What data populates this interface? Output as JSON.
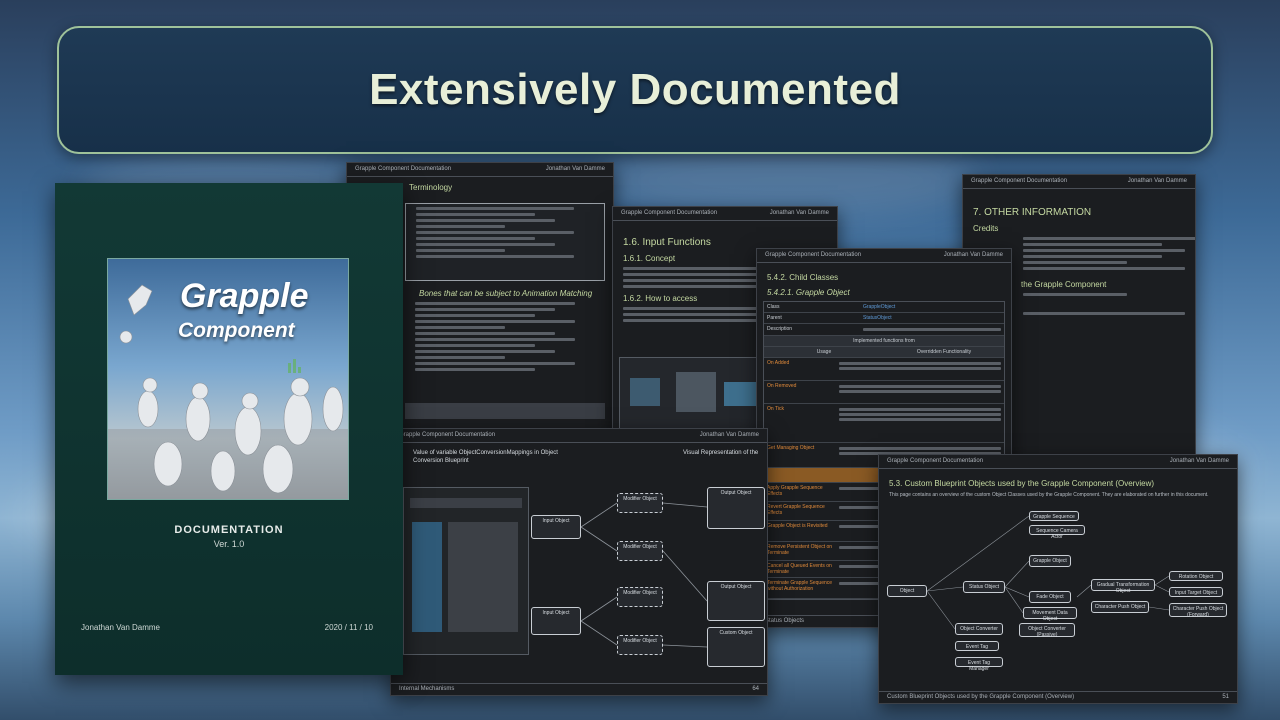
{
  "title": "Extensively Documented",
  "cover": {
    "logo_line1": "Grapple",
    "logo_line2": "Component",
    "doc_label": "DOCUMENTATION",
    "version": "Ver. 1.0",
    "author": "Jonathan Van Damme",
    "date": "2020 / 11 / 10"
  },
  "pages": {
    "terminology": {
      "header_left": "Grapple Component Documentation",
      "header_right": "Jonathan Van Damme",
      "section": "Terminology",
      "section2": "Bones that can be subject to Animation Matching"
    },
    "input_functions": {
      "header_left": "Grapple Component Documentation",
      "header_right": "Jonathan Van Damme",
      "section": "1.6.    Input Functions",
      "sub1": "1.6.1. Concept",
      "sub2": "1.6.2. How to access"
    },
    "other_info": {
      "header_left": "Grapple Component Documentation",
      "header_right": "Jonathan Van Damme",
      "section": "7.   OTHER INFORMATION",
      "sub1": "Credits",
      "sub2": "the Grapple Component"
    },
    "child_classes": {
      "header_left": "Grapple Component Documentation",
      "header_right": "Jonathan Van Damme",
      "section": "5.4.2. Child Classes",
      "sub1": "5.4.2.1.      Grapple Object",
      "table_head_left": "Usage",
      "table_head_right": "Overridden Functionality",
      "table_title": "Implemented functions from",
      "rows": [
        "Class",
        "Parent",
        "Description",
        "On Added",
        "On Removed",
        "On Tick",
        "Get Managing Object",
        "Apply Grapple Sequence Effects",
        "Revert Grapple Sequence Effects",
        "Grapple Object is Revisited",
        "Remove Persistent Object on Terminate",
        "Cancel all Queued Events on Terminate",
        "Terminate Grapple Sequence without Authorization"
      ],
      "footer_left": "Status Objects"
    },
    "variable": {
      "header_left": "Grapple Component Documentation",
      "header_right": "Jonathan Van Damme",
      "title_left": "Value of variable ObjectConversionMappings in Object Conversion Blueprint",
      "title_right": "Visual Representation of the",
      "node_input1": "Input Object",
      "node_input2": "Input Object",
      "node_mod1": "Modifier Object",
      "node_mod2": "Modifier Object",
      "node_mod3": "Modifier Object",
      "node_mod4": "Modifier Object",
      "node_out1": "Output Object",
      "node_out2": "Output Object",
      "node_out3": "Custom Object",
      "footer_left": "Internal Mechanisms",
      "footer_right": "64"
    },
    "custom_objects": {
      "header_left": "Grapple Component Documentation",
      "header_right": "Jonathan Van Damme",
      "section": "5.3.  Custom Blueprint Objects used by the Grapple Component (Overview)",
      "intro": "This page contains an overview of the custom Object Classes used by the Grapple Component. They are elaborated on further in this document.",
      "nodes": [
        "Object",
        "Status Object",
        "Grapple Object",
        "Fade Object",
        "Movement Data Object",
        "Object Converter",
        "Event Tag",
        "Event Tag Manager",
        "Grapple Sequence",
        "Sequence Camera Actor",
        "Gradual Transformation Object",
        "Character Push Object",
        "Object Converter (Passive)"
      ],
      "nodes_right": [
        "Rotation Object",
        "Input Target Object",
        "Character Push Object (Forward)"
      ],
      "footer_left": "Custom Blueprint Objects used by the Grapple Component (Overview)",
      "footer_right": "51"
    }
  }
}
